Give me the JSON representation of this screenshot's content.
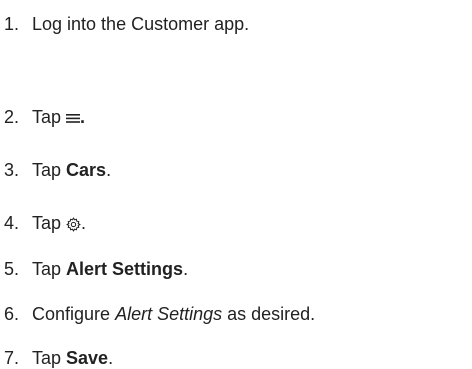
{
  "steps": [
    {
      "number": "1.",
      "text": "Log into the Customer app."
    },
    {
      "number": "2.",
      "prefix": "Tap ",
      "icon": "hamburger-menu-icon",
      "suffix": "."
    },
    {
      "number": "3.",
      "prefix": "Tap ",
      "bold": "Cars",
      "suffix": "."
    },
    {
      "number": "4.",
      "prefix": "Tap ",
      "icon": "gear-icon",
      "suffix": "."
    },
    {
      "number": "5.",
      "prefix": "Tap ",
      "bold": "Alert Settings",
      "suffix": "."
    },
    {
      "number": "6.",
      "prefix": "Configure ",
      "italic": "Alert Settings",
      "suffix": " as desired."
    },
    {
      "number": "7.",
      "prefix": "Tap ",
      "bold": "Save",
      "suffix": "."
    }
  ]
}
